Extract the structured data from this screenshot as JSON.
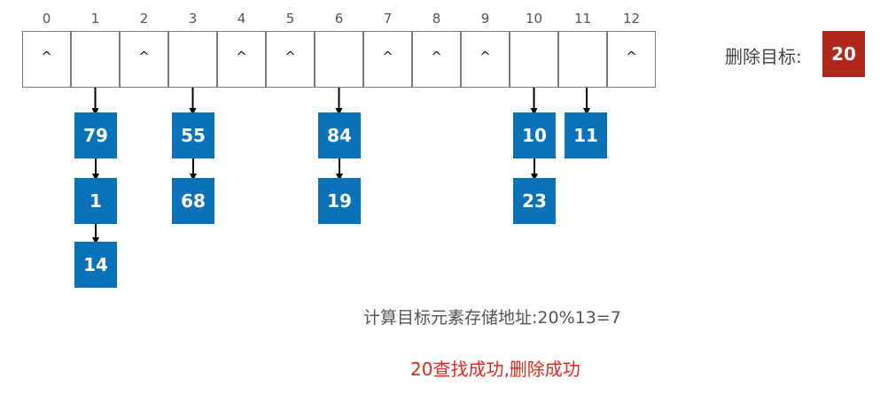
{
  "table": {
    "indices": [
      "0",
      "1",
      "2",
      "3",
      "4",
      "5",
      "6",
      "7",
      "8",
      "9",
      "10",
      "11",
      "12"
    ],
    "empty_marker": "^",
    "empty_slots": [
      0,
      2,
      4,
      5,
      7,
      8,
      9,
      12
    ]
  },
  "chains": [
    {
      "slot": 1,
      "nodes": [
        "79",
        "1",
        "14"
      ]
    },
    {
      "slot": 3,
      "nodes": [
        "55",
        "68"
      ]
    },
    {
      "slot": 6,
      "nodes": [
        "84",
        "19"
      ]
    },
    {
      "slot": 10,
      "nodes": [
        "10",
        "23"
      ]
    },
    {
      "slot": 11,
      "nodes": [
        "11"
      ]
    }
  ],
  "target": {
    "label": "删除目标:",
    "value": "20"
  },
  "calculation": "计算目标元素存储地址:20%13=7",
  "result": "20查找成功,删除成功",
  "colors": {
    "node": "#0a72b8",
    "target": "#b0261c",
    "result": "#e0281c"
  }
}
